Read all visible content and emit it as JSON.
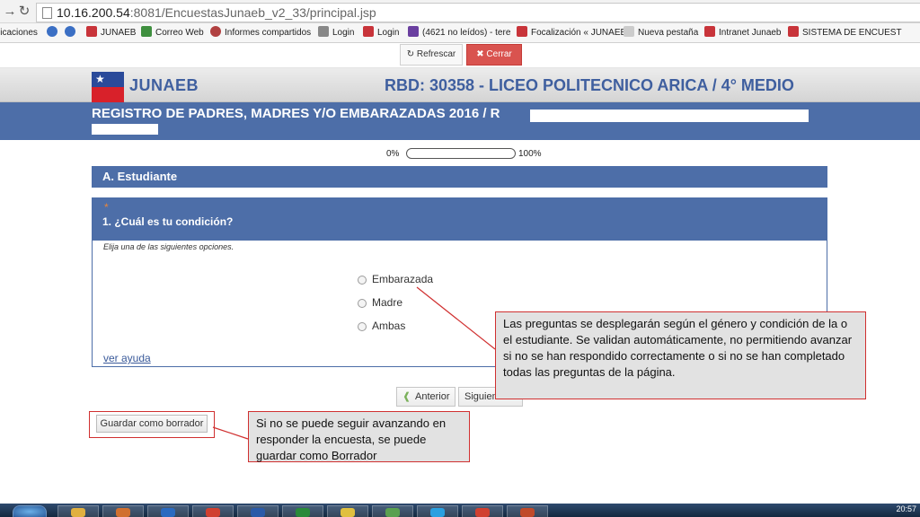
{
  "browser": {
    "url_host": "10.16.200.54",
    "url_rest": ":8081/EncuestasJunaeb_v2_33/principal.jsp",
    "bookmarks": [
      {
        "label": "licaciones",
        "color": "#8a8a8a"
      },
      {
        "label": "",
        "color": "#3b6fc4"
      },
      {
        "label": "",
        "color": "#3b6fc4"
      },
      {
        "label": "JUNAEB",
        "color": "#c8343a"
      },
      {
        "label": "Correo Web",
        "color": "#3f8f3f"
      },
      {
        "label": "Informes compartidos",
        "color": "#b04040"
      },
      {
        "label": "Login",
        "color": "#888888"
      },
      {
        "label": "Login",
        "color": "#c8343a"
      },
      {
        "label": "(4621 no leídos) - tere",
        "color": "#6a3fa0"
      },
      {
        "label": "Focalización « JUNAEB",
        "color": "#c8343a"
      },
      {
        "label": "Nueva pestaña",
        "color": "#cccccc"
      },
      {
        "label": "Intranet Junaeb",
        "color": "#c8343a"
      },
      {
        "label": "SISTEMA DE ENCUEST",
        "color": "#c8343a"
      }
    ]
  },
  "toolbar": {
    "refresh_label": "Refrescar",
    "close_label": "Cerrar"
  },
  "header": {
    "brand": "JUNAEB",
    "rbd": "RBD: 30358 - LICEO POLITECNICO ARICA / 4° MEDIO",
    "registry_title": "REGISTRO DE PADRES, MADRES Y/O EMBARAZADAS 2016 / R"
  },
  "progress": {
    "min_label": "0%",
    "max_label": "100%",
    "value": 0
  },
  "section": {
    "title": "A. Estudiante"
  },
  "question": {
    "required_mark": "*",
    "title": "1. ¿Cuál es tu condición?",
    "instruction": "Elija una de las siguientes opciones.",
    "options": [
      "Embarazada",
      "Madre",
      "Ambas"
    ],
    "help_label": "ver ayuda"
  },
  "nav": {
    "prev_label": "Anterior",
    "next_label": "Siguiente",
    "draft_label": "Guardar como borrador"
  },
  "callouts": {
    "questions_note": "Las preguntas se desplegarán según el género y condición de la o el estudiante. Se validan automáticamente, no permitiendo avanzar si no se han respondido correctamente o si no se han completado todas las preguntas de la página.",
    "draft_note": "Si no se puede seguir avanzando en responder la encuesta, se puede guardar como Borrador"
  },
  "taskbar": {
    "clock": "20:57",
    "apps": [
      {
        "icon": "folder-icon",
        "color": "#e0b040"
      },
      {
        "icon": "media-icon",
        "color": "#d07030"
      },
      {
        "icon": "outlook-icon",
        "color": "#2a6ac0"
      },
      {
        "icon": "chrome-icon",
        "color": "#d04030"
      },
      {
        "icon": "word-icon",
        "color": "#2a5aa8"
      },
      {
        "icon": "excel-icon",
        "color": "#2a8a3a"
      },
      {
        "icon": "notes-icon",
        "color": "#e0c040"
      },
      {
        "icon": "images-icon",
        "color": "#5aa050"
      },
      {
        "icon": "skype-icon",
        "color": "#2aa0e0"
      },
      {
        "icon": "chrome-icon",
        "color": "#d04030"
      },
      {
        "icon": "powerpoint-icon",
        "color": "#c04a2a"
      }
    ]
  }
}
